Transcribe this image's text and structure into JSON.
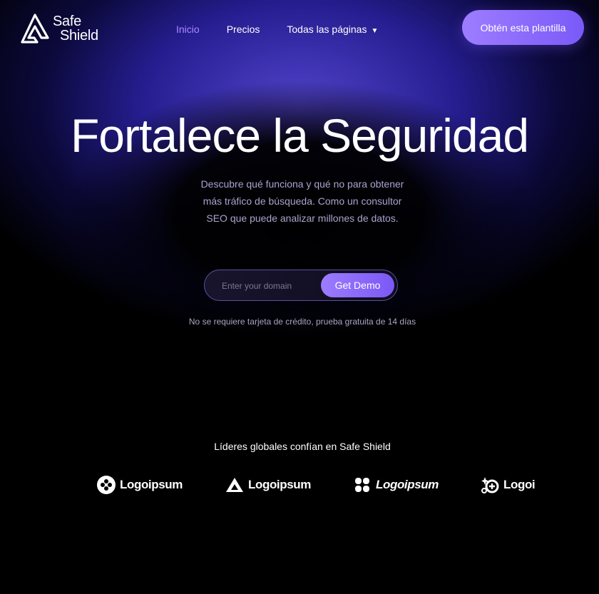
{
  "brand": {
    "line1": "Safe",
    "line2": "Shield",
    "icon": "triangle-logo-icon"
  },
  "nav": {
    "items": [
      "Inicio",
      "Precios",
      "Todas las páginas"
    ],
    "active": "Inicio",
    "dropdown_icon": "caret-down-icon"
  },
  "cta": {
    "label": "Obtén esta plantilla"
  },
  "hero": {
    "title": "Fortalece la Seguridad",
    "subtitle": "Descubre qué funciona y qué no para obtener más tráfico de búsqueda. Como un consultor SEO que puede analizar millones de datos."
  },
  "form": {
    "placeholder": "Enter your domain",
    "value": "",
    "button_label": "Get Demo"
  },
  "note": "No se requiere tarjeta de crédito, prueba gratuita de 14 días",
  "trust": {
    "heading": "Líderes globales confían en Safe Shield",
    "logos": [
      {
        "name": "Logoipsum",
        "icon": "circle-logo-icon"
      },
      {
        "name": "Logoipsum",
        "icon": "triangle-logo-icon"
      },
      {
        "name": "Logoipsum",
        "icon": "quad-logo-icon"
      },
      {
        "name": "Logoipsum",
        "icon": "sparkle-logo-icon"
      }
    ]
  },
  "colors": {
    "background": "#000000",
    "accent": "#8a6bff",
    "nav_active": "#a98bff",
    "glow": "#4a3ad0"
  }
}
